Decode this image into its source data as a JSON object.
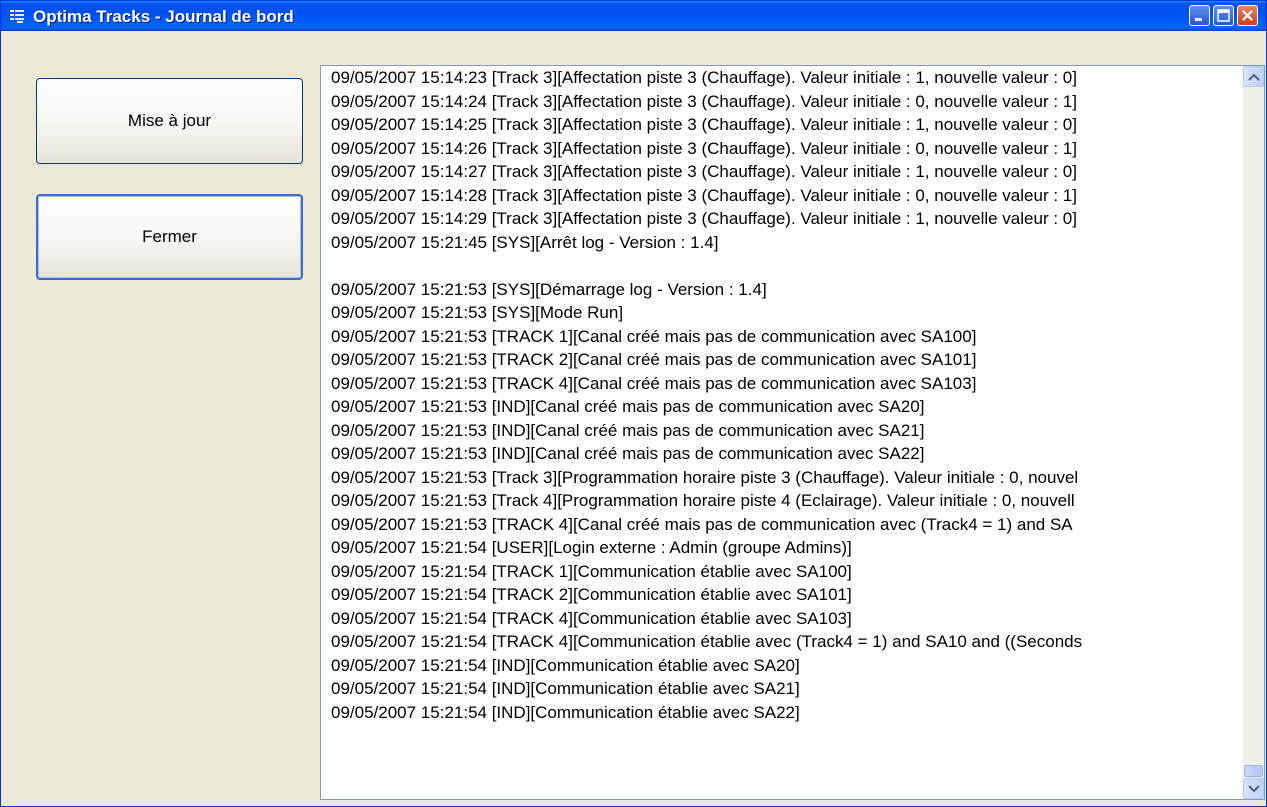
{
  "window": {
    "title": "Optima Tracks - Journal de bord",
    "app_icon": "log-list-icon",
    "controls": [
      "minimize-icon",
      "maximize-icon",
      "close-icon"
    ]
  },
  "buttons": {
    "update_label": "Mise à jour",
    "close_label": "Fermer"
  },
  "log": {
    "selected_index": 28,
    "selection_color": "#316ac5",
    "lines": [
      "09/05/2007 15:14:23 [Track 3][Affectation piste 3 (Chauffage). Valeur initiale : 1, nouvelle valeur : 0]",
      "09/05/2007 15:14:24 [Track 3][Affectation piste 3 (Chauffage). Valeur initiale : 0, nouvelle valeur : 1]",
      "09/05/2007 15:14:25 [Track 3][Affectation piste 3 (Chauffage). Valeur initiale : 1, nouvelle valeur : 0]",
      "09/05/2007 15:14:26 [Track 3][Affectation piste 3 (Chauffage). Valeur initiale : 0, nouvelle valeur : 1]",
      "09/05/2007 15:14:27 [Track 3][Affectation piste 3 (Chauffage). Valeur initiale : 1, nouvelle valeur : 0]",
      "09/05/2007 15:14:28 [Track 3][Affectation piste 3 (Chauffage). Valeur initiale : 0, nouvelle valeur : 1]",
      "09/05/2007 15:14:29 [Track 3][Affectation piste 3 (Chauffage). Valeur initiale : 1, nouvelle valeur : 0]",
      "09/05/2007 15:21:45 [SYS][Arrêt log - Version : 1.4]",
      "",
      "09/05/2007 15:21:53 [SYS][Démarrage log - Version : 1.4]",
      "09/05/2007 15:21:53 [SYS][Mode Run]",
      "09/05/2007 15:21:53 [TRACK 1][Canal créé mais pas de communication avec SA100]",
      "09/05/2007 15:21:53 [TRACK 2][Canal créé mais pas de communication avec SA101]",
      "09/05/2007 15:21:53 [TRACK 4][Canal créé mais pas de communication avec SA103]",
      "09/05/2007 15:21:53 [IND][Canal créé mais pas de communication avec SA20]",
      "09/05/2007 15:21:53 [IND][Canal créé mais pas de communication avec SA21]",
      "09/05/2007 15:21:53 [IND][Canal créé mais pas de communication avec SA22]",
      "09/05/2007 15:21:53 [Track 3][Programmation horaire piste 3 (Chauffage). Valeur initiale : 0, nouvel",
      "09/05/2007 15:21:53 [Track 4][Programmation horaire piste 4 (Eclairage). Valeur initiale : 0, nouvell",
      "09/05/2007 15:21:53 [TRACK 4][Canal créé mais pas de communication avec (Track4 = 1) and SA",
      "09/05/2007 15:21:54 [USER][Login externe : Admin (groupe Admins)]",
      "09/05/2007 15:21:54 [TRACK 1][Communication établie avec SA100]",
      "09/05/2007 15:21:54 [TRACK 2][Communication établie avec SA101]",
      "09/05/2007 15:21:54 [TRACK 4][Communication établie avec SA103]",
      "09/05/2007 15:21:54 [TRACK 4][Communication établie avec (Track4 = 1) and SA10 and ((Seconds",
      "09/05/2007 15:21:54 [IND][Communication établie avec SA20]",
      "09/05/2007 15:21:54 [IND][Communication établie avec SA21]",
      "09/05/2007 15:21:54 [IND][Communication établie avec SA22]"
    ]
  },
  "scrollbar": {
    "position": 1.0,
    "up_icon": "scroll-up-arrow-icon",
    "down_icon": "scroll-down-arrow-icon"
  }
}
